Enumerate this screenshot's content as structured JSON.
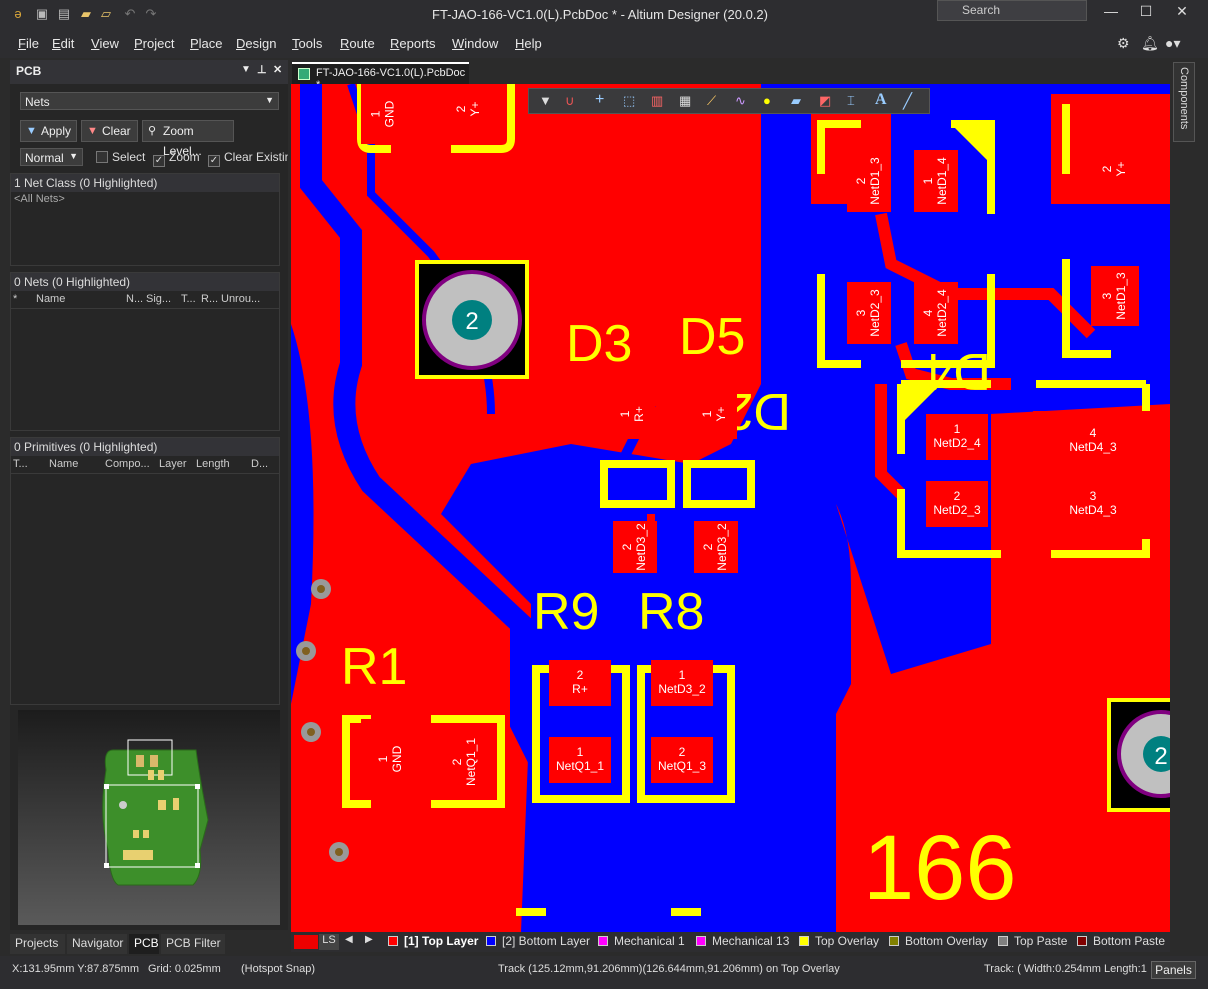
{
  "window": {
    "title": "FT-JAO-166-VC1.0(L).PcbDoc * - Altium Designer (20.0.2)",
    "search_placeholder": "Search"
  },
  "menu": [
    "File",
    "Edit",
    "View",
    "Project",
    "Place",
    "Design",
    "Tools",
    "Route",
    "Reports",
    "Window",
    "Help"
  ],
  "panel": {
    "title": "PCB",
    "mode": "Nets",
    "buttons": {
      "apply": "Apply",
      "clear": "Clear",
      "zoom_level": "Zoom Level..."
    },
    "filter_mode": "Normal",
    "checks": {
      "select": "Select",
      "zoom": "Zoom",
      "clear_existing": "Clear Existin"
    },
    "net_class_header": "1 Net Class (0 Highlighted)",
    "all_nets": "<All Nets>",
    "nets_header": "0 Nets (0 Highlighted)",
    "nets_cols": [
      "*",
      "Name",
      "N...",
      "Sig...",
      "T...",
      "R...",
      "Unrou..."
    ],
    "prims_header": "0 Primitives (0 Highlighted)",
    "prims_cols": [
      "T...",
      "Name",
      "Compo...",
      "Layer",
      "Length",
      "D..."
    ]
  },
  "bottom_tabs": [
    "Projects",
    "Navigator",
    "PCB",
    "PCB Filter"
  ],
  "doc_tab": "FT-JAO-166-VC1.0(L).PcbDoc *",
  "right_panel": "Components",
  "layers": {
    "ls": "LS",
    "items": [
      {
        "name": "[1] Top Layer",
        "color": "#ff0000"
      },
      {
        "name": "[2] Bottom Layer",
        "color": "#0000ff"
      },
      {
        "name": "Mechanical 1",
        "color": "#ff00ff"
      },
      {
        "name": "Mechanical 13",
        "color": "#ff00ff"
      },
      {
        "name": "Top Overlay",
        "color": "#ffff00"
      },
      {
        "name": "Bottom Overlay",
        "color": "#808000"
      },
      {
        "name": "Top Paste",
        "color": "#808080"
      },
      {
        "name": "Bottom Paste",
        "color": "#800000"
      }
    ]
  },
  "status": {
    "coords": "X:131.95mm Y:87.875mm",
    "grid": "Grid: 0.025mm",
    "snap": "(Hotspot Snap)",
    "info": "Track (125.12mm,91.206mm)(126.644mm,91.206mm) on Top Overlay",
    "track": "Track: ( Width:0.254mm Length:1",
    "panels": "Panels"
  },
  "pcb": {
    "designators": [
      "D3",
      "D5",
      "D2",
      "D4",
      "R9",
      "R8",
      "R1",
      "166",
      "2"
    ],
    "pads": [
      {
        "num": "1",
        "net": "GND"
      },
      {
        "num": "2",
        "net": "Y+"
      },
      {
        "num": "2",
        "net": "NetD1_3"
      },
      {
        "num": "1",
        "net": "NetD1_4"
      },
      {
        "num": "2",
        "net": "Y+"
      },
      {
        "num": "3",
        "net": "NetD2_3"
      },
      {
        "num": "4",
        "net": "NetD2_4"
      },
      {
        "num": "3",
        "net": "NetD1_3"
      },
      {
        "num": "1",
        "net": "R+"
      },
      {
        "num": "1",
        "net": "Y+"
      },
      {
        "num": "1",
        "net": "NetD2_4"
      },
      {
        "num": "4",
        "net": "NetD4_3"
      },
      {
        "num": "2",
        "net": "NetD3_2"
      },
      {
        "num": "2",
        "net": "NetD3_2"
      },
      {
        "num": "2",
        "net": "NetD2_3"
      },
      {
        "num": "3",
        "net": "NetD4_3"
      },
      {
        "num": "2",
        "net": "R+"
      },
      {
        "num": "1",
        "net": "NetD3_2"
      },
      {
        "num": "1",
        "net": "GND"
      },
      {
        "num": "2",
        "net": "NetQ1_1"
      },
      {
        "num": "1",
        "net": "NetQ1_1"
      },
      {
        "num": "2",
        "net": "NetQ1_3"
      }
    ]
  }
}
